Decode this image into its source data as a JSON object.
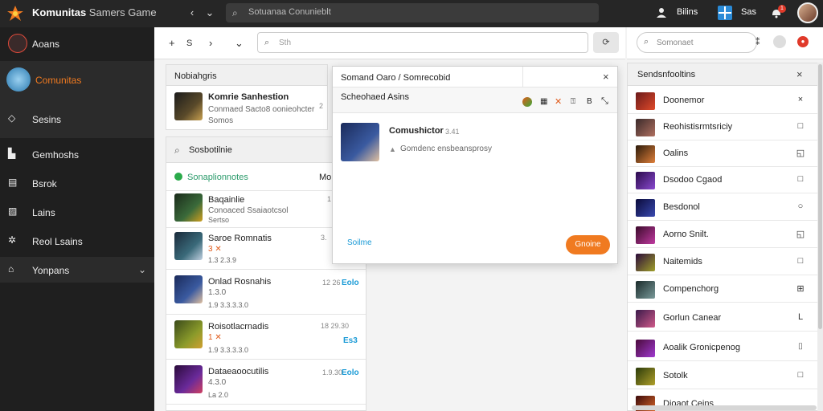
{
  "topbar": {
    "title_bold": "Komunitas",
    "title_rest": "Samers Game",
    "search_placeholder": "Sotuanaa Conunieblt",
    "user_label": "Bilins",
    "badge_label": "Sas",
    "notif_count": "1"
  },
  "sidebar": {
    "items": [
      {
        "label": "Aoans",
        "icon": "avatar-icon"
      },
      {
        "label": "Comunitas",
        "icon": "globe-icon",
        "active": true
      },
      {
        "label": "Sesins",
        "icon": "controller-icon"
      },
      {
        "label": "Gemhoshs",
        "icon": "building-icon"
      },
      {
        "label": "Bsrok",
        "icon": "list-icon"
      },
      {
        "label": "Lains",
        "icon": "chart-icon"
      },
      {
        "label": "Reol Lsains",
        "icon": "gear-icon"
      },
      {
        "label": "Yonpans",
        "icon": "home-icon"
      }
    ],
    "accent_color": "#f07a20"
  },
  "toolbar": {
    "add": "+",
    "s_label": "S",
    "search_placeholder": "Sth",
    "refresh": "⟳"
  },
  "featured": {
    "header": "Nobiahgris",
    "title": "Komrie Sanhestion",
    "sub": "Conmaed Sacto8 oonieohcter",
    "meta": "Somos",
    "badge": "2"
  },
  "list": {
    "search_label": "Sosbotilnie",
    "filter_label": "Sonaplionnotes",
    "filter_right": "Mo",
    "rows": [
      {
        "title": "Baqainlie",
        "sub": "Conoaced Ssaiaotcsol",
        "meta": "Sertso",
        "num": "1",
        "tag": ""
      },
      {
        "title": "Saroe Romnatis",
        "sub": "3 ✕",
        "meta": "1.3 2.3.9",
        "num": "3.",
        "tag": ""
      },
      {
        "title": "Onlad Rosnahis",
        "sub": "1.3.0",
        "meta": "1.9 3.3.3.3.0",
        "num": "12 26",
        "tag": "Eolo"
      },
      {
        "title": "Roisotlacrnadis",
        "sub": "1 ✕",
        "meta": "1.9 3.3.3.3.0",
        "num": "18 29.30",
        "tag": "Es3"
      },
      {
        "title": "Dataeaoocutilis",
        "sub": "4.3.0",
        "meta": "La 2.0",
        "num": "1.9.30",
        "tag": "Eolo"
      }
    ]
  },
  "popup": {
    "title": "Somand Oaro / Somrecobid",
    "subtitle": "Scheohaed Asins",
    "item_name": "Comushictor",
    "item_extra": "3.41",
    "item_desc": "Gomdenc ensbeansprosy",
    "link": "Soilme",
    "button": "Gnoine"
  },
  "right": {
    "search_placeholder": "Somonaet",
    "header": "Sendsnfooltins",
    "rows": [
      {
        "label": "Doonemor",
        "act": "×",
        "c1": "#6a1a1a",
        "c2": "#e04a2a"
      },
      {
        "label": "Reohistisrmtsriciy",
        "act": "□",
        "c1": "#3a2a2a",
        "c2": "#b07060"
      },
      {
        "label": "Oalins",
        "act": "◱",
        "c1": "#2a1a0a",
        "c2": "#e0803a"
      },
      {
        "label": "Dsodoo Cgaod",
        "act": "□",
        "c1": "#2a0a4a",
        "c2": "#8a4ad0"
      },
      {
        "label": "Besdonol",
        "act": "○",
        "c1": "#0a0a3a",
        "c2": "#3a4ab0"
      },
      {
        "label": "Aorno Snilt.",
        "act": "◱",
        "c1": "#3a0a2a",
        "c2": "#c03aa0"
      },
      {
        "label": "Naitemids",
        "act": "□",
        "c1": "#2a0a3a",
        "c2": "#a0a02a"
      },
      {
        "label": "Compenchorg",
        "act": "⊞",
        "c1": "#1a2a2a",
        "c2": "#7a9a9a"
      },
      {
        "label": "Gorlun Canear",
        "act": "L",
        "c1": "#3a1a4a",
        "c2": "#d05a8a"
      },
      {
        "label": "Aoalik Gronicpenog",
        "act": "⌷",
        "c1": "#4a0a3a",
        "c2": "#a03ad0"
      },
      {
        "label": "Sotolk",
        "act": "□",
        "c1": "#2a3a0a",
        "c2": "#b0a02a"
      },
      {
        "label": "Dioaot Ceins",
        "act": "",
        "c1": "#3a0a0a",
        "c2": "#e06a2a"
      }
    ]
  }
}
